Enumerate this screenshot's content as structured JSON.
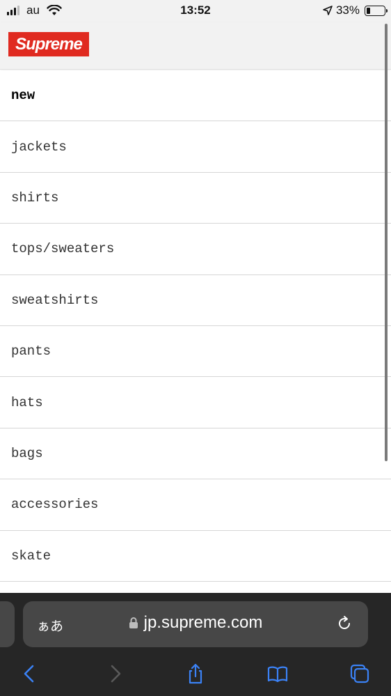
{
  "status_bar": {
    "carrier": "au",
    "time": "13:52",
    "battery": "33%",
    "battery_level": 0.33
  },
  "header": {
    "logo_text": "Supreme",
    "logo_color": "#e02a20"
  },
  "menu": {
    "items": [
      {
        "label": "new",
        "bold": true
      },
      {
        "label": "jackets"
      },
      {
        "label": "shirts"
      },
      {
        "label": "tops/sweaters"
      },
      {
        "label": "sweatshirts"
      },
      {
        "label": "pants"
      },
      {
        "label": "hats"
      },
      {
        "label": "bags"
      },
      {
        "label": "accessories"
      },
      {
        "label": "skate"
      }
    ]
  },
  "browser": {
    "text_size_label": "ぁあ",
    "url": "jp.supreme.com",
    "accent_color": "#3b82f6",
    "icons": [
      "back-icon",
      "forward-icon",
      "share-icon",
      "bookmarks-icon",
      "tabs-icon",
      "lock-icon",
      "reload-icon"
    ]
  }
}
